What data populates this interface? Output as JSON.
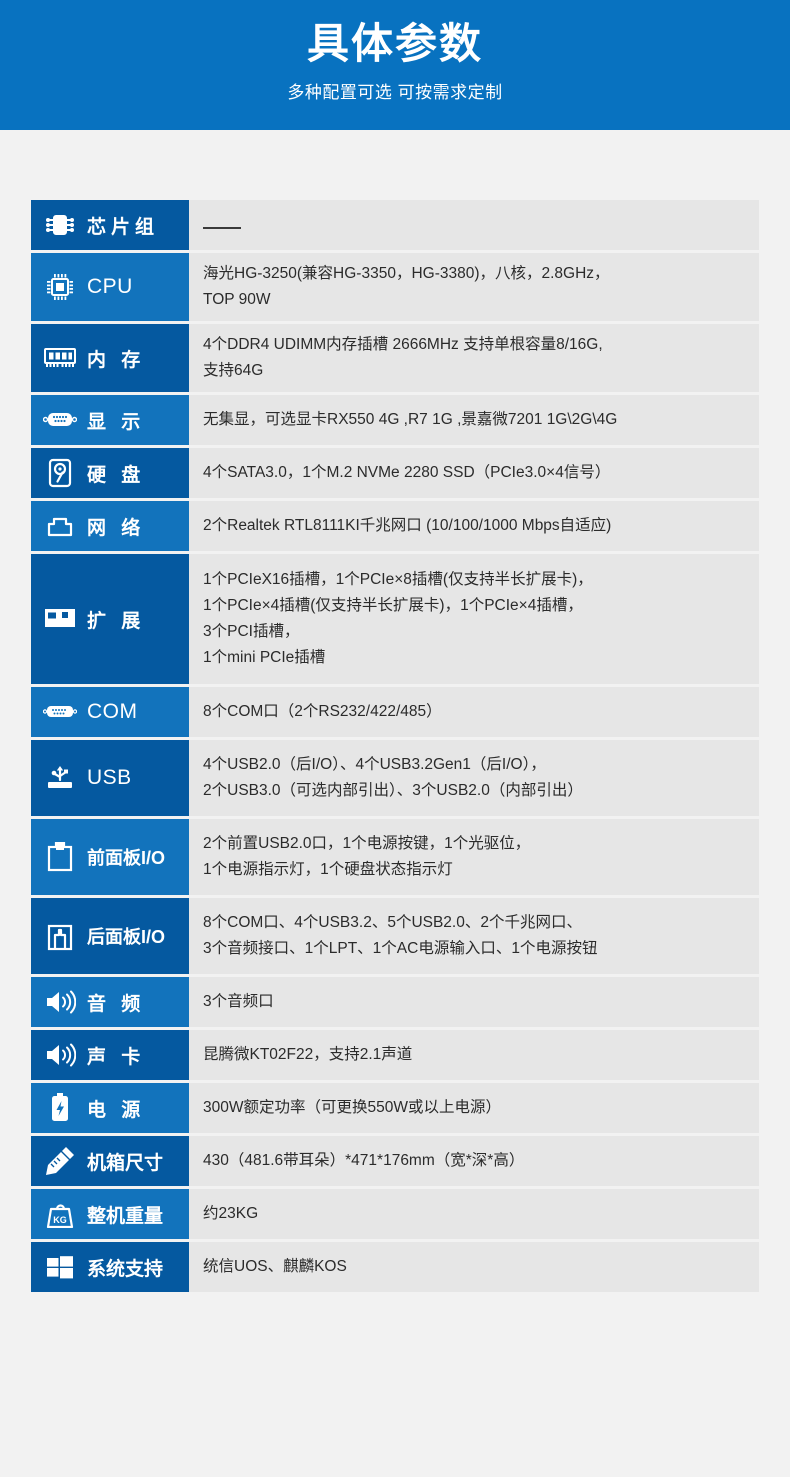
{
  "banner": {
    "title": "具体参数",
    "subtitle": "多种配置可选 可按需求定制",
    "background_color": "#0872c0"
  },
  "colors": {
    "label_dark": "#0559a0",
    "label_light": "#1273bc",
    "value_background": "#e6e6e6",
    "page_background": "#f2f2f2",
    "value_text": "#2b2b2b"
  },
  "spec_table": {
    "rows": [
      {
        "icon": "chip-icon",
        "label": "芯片组",
        "shade": "dark",
        "lines": [
          "—"
        ],
        "is_dash": true
      },
      {
        "icon": "cpu-icon",
        "label": "CPU",
        "shade": "light",
        "lines": [
          "海光HG-3250(兼容HG-3350，HG-3380)，八核，2.8GHz，",
          "TOP 90W"
        ]
      },
      {
        "icon": "memory-icon",
        "label": "内 存",
        "shade": "dark",
        "lines": [
          "4个DDR4 UDIMM内存插槽  2666MHz 支持单根容量8/16G,",
          "支持64G"
        ]
      },
      {
        "icon": "vga-display-icon",
        "label": "显 示",
        "shade": "light",
        "lines": [
          "无集显，可选显卡RX550 4G ,R7  1G  ,景嘉微7201 1G\\2G\\4G"
        ]
      },
      {
        "icon": "harddisk-icon",
        "label": "硬 盘",
        "shade": "dark",
        "lines": [
          "4个SATA3.0，1个M.2 NVMe 2280 SSD（PCIe3.0×4信号）"
        ]
      },
      {
        "icon": "network-icon",
        "label": "网 络",
        "shade": "light",
        "lines": [
          "2个Realtek RTL8111KI千兆网口 (10/100/1000 Mbps自适应)"
        ]
      },
      {
        "icon": "expansion-card-icon",
        "label": "扩 展",
        "shade": "dark",
        "lines": [
          "1个PCIeX16插槽，1个PCIe×8插槽(仅支持半长扩展卡)，",
          "1个PCIe×4插槽(仅支持半长扩展卡)，1个PCIe×4插槽，",
          "3个PCI插槽，",
          "1个mini PCIe插槽"
        ]
      },
      {
        "icon": "com-port-icon",
        "label": "COM",
        "shade": "light",
        "lines": [
          "8个COM口（2个RS232/422/485）"
        ]
      },
      {
        "icon": "usb-icon",
        "label": "USB",
        "shade": "dark",
        "lines": [
          "4个USB2.0（后I/O）、4个USB3.2Gen1（后I/O），",
          "2个USB3.0（可选内部引出）、3个USB2.0（内部引出）"
        ]
      },
      {
        "icon": "front-panel-icon",
        "label": "前面板I/O",
        "shade": "light",
        "lines": [
          "2个前置USB2.0口，1个电源按键，1个光驱位，",
          "1个电源指示灯，1个硬盘状态指示灯"
        ]
      },
      {
        "icon": "rear-panel-icon",
        "label": "后面板I/O",
        "shade": "dark",
        "lines": [
          "8个COM口、4个USB3.2、5个USB2.0、2个千兆网口、",
          "3个音频接口、1个LPT、1个AC电源输入口、1个电源按钮"
        ]
      },
      {
        "icon": "speaker-icon",
        "label": "音 频",
        "shade": "light",
        "lines": [
          "3个音频口"
        ]
      },
      {
        "icon": "speaker-icon",
        "label": "声 卡",
        "shade": "dark",
        "lines": [
          "昆腾微KT02F22，支持2.1声道"
        ]
      },
      {
        "icon": "battery-power-icon",
        "label": "电 源",
        "shade": "light",
        "lines": [
          "300W额定功率（可更换550W或以上电源）"
        ]
      },
      {
        "icon": "ruler-pencil-icon",
        "label": "机箱尺寸",
        "shade": "dark",
        "lines": [
          "430（481.6带耳朵）*471*176mm（宽*深*高）"
        ]
      },
      {
        "icon": "weight-kg-icon",
        "label": "整机重量",
        "shade": "light",
        "lines": [
          "约23KG"
        ]
      },
      {
        "icon": "windows-os-icon",
        "label": "系统支持",
        "shade": "dark",
        "lines": [
          "统信UOS、麒麟KOS"
        ]
      }
    ]
  }
}
